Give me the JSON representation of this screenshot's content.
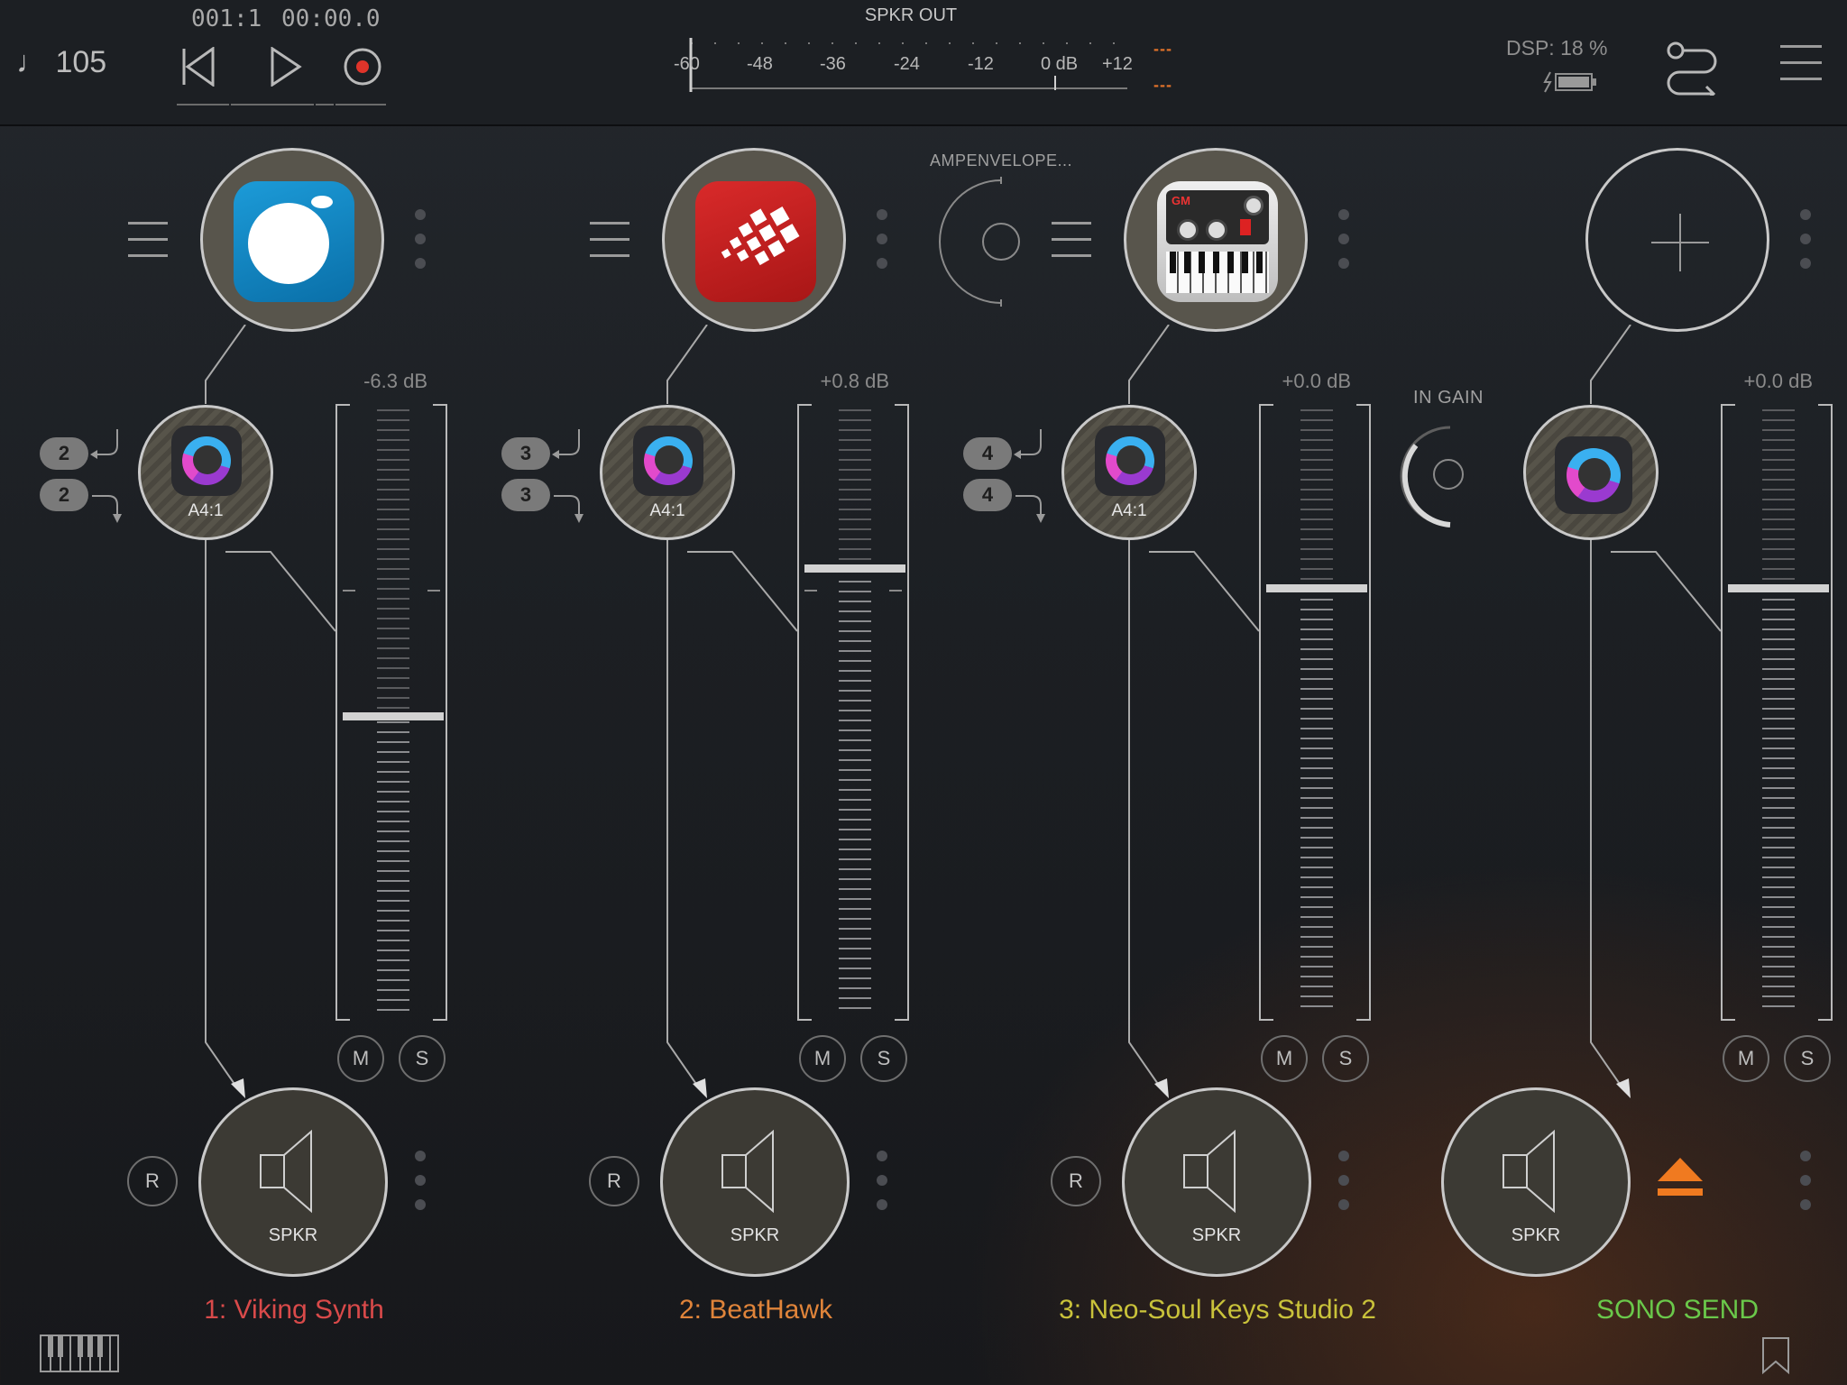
{
  "transport": {
    "tempo": "105",
    "bar_position": "001:1",
    "time_position": "00:00.0"
  },
  "output_meter": {
    "title": "SPKR OUT",
    "scale": [
      "-60",
      "-48",
      "-36",
      "-24",
      "-12",
      "0 dB",
      "+12"
    ],
    "peak_left": "---",
    "peak_right": "---"
  },
  "status": {
    "dsp": "DSP: 18 %"
  },
  "colors": {
    "ch1": "#d94a4a",
    "ch2": "#e0843a",
    "ch3": "#c9c23a",
    "ch4": "#6ac84a",
    "eject": "#f07a20"
  },
  "channels": [
    {
      "name": "1: Viking Synth",
      "instrument_icon": "viking-synth-icon",
      "fx_label": "A4:1",
      "fx_icon": "fx-plugin-icon",
      "route_in": "2",
      "route_out": "2",
      "gain_db": "-6.3 dB",
      "fader_level": 0.49,
      "mute": "M",
      "solo": "S",
      "record": "R",
      "output": "SPKR"
    },
    {
      "name": "2: BeatHawk",
      "instrument_icon": "beathawk-icon",
      "fx_label": "A4:1",
      "fx_icon": "fx-plugin-icon",
      "route_in": "3",
      "route_out": "3",
      "gain_db": "+0.8 dB",
      "fader_level": 0.72,
      "mute": "M",
      "solo": "S",
      "record": "R",
      "output": "SPKR",
      "param_label": "AMPENVELOPE..."
    },
    {
      "name": "3: Neo-Soul Keys Studio 2",
      "instrument_icon": "neo-soul-keys-icon",
      "fx_label": "A4:1",
      "fx_icon": "fx-plugin-icon",
      "route_in": "4",
      "route_out": "4",
      "gain_db": "+0.0 dB",
      "fader_level": 0.7,
      "mute": "M",
      "solo": "S",
      "record": "R",
      "output": "SPKR",
      "param_label": "IN GAIN"
    },
    {
      "name": "SONO SEND",
      "instrument_icon": "add-icon",
      "fx_icon": "fx-plugin-icon",
      "gain_db": "+0.0 dB",
      "fader_level": 0.7,
      "mute": "M",
      "solo": "S",
      "output": "SPKR"
    }
  ]
}
